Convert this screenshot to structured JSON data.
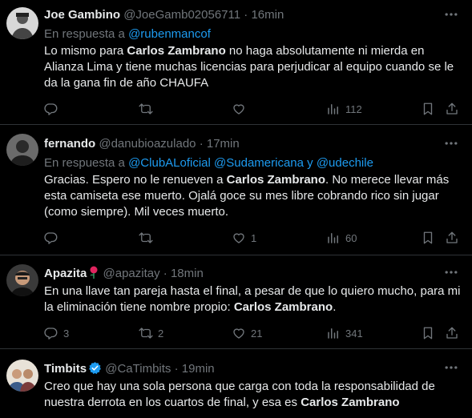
{
  "tweets": [
    {
      "name": "Joe Gambino",
      "handle": "@JoeGamb02056711",
      "dot": "·",
      "time": "16min",
      "reply_prefix": "En respuesta a ",
      "reply_targets": [
        "@rubenmancof"
      ],
      "text_parts": [
        "Lo mismo para ",
        "Carlos Zambrano",
        " no haga absolutamente ni mierda en Alianza Lima y tiene muchas licencias para perjudicar al equipo cuando se le da la gana fin de año CHAUFA"
      ],
      "replies": "",
      "retweets": "",
      "likes": "",
      "views": "112"
    },
    {
      "name": "fernando",
      "handle": "@danubioazulado",
      "dot": "·",
      "time": "17min",
      "reply_prefix": "En respuesta a ",
      "reply_targets": [
        "@ClubALoficial",
        "@Sudamericana",
        "@udechile"
      ],
      "reply_joiners": [
        " ",
        " y "
      ],
      "text_parts": [
        "Gracias. Espero no le renueven a ",
        "Carlos Zambrano",
        ". No merece llevar más esta camiseta ese muerto. Ojalá goce su mes libre cobrando rico sin jugar (como siempre). Mil veces muerto."
      ],
      "replies": "",
      "retweets": "",
      "likes": "1",
      "views": "60"
    },
    {
      "name": "Apazita",
      "handle": "@apazitay",
      "dot": "·",
      "time": "18min",
      "text_parts": [
        "En una llave tan pareja hasta el final, a pesar de que lo quiero mucho, para mi la eliminación tiene nombre propio: ",
        "Carlos Zambrano",
        "."
      ],
      "replies": "3",
      "retweets": "2",
      "likes": "21",
      "views": "341"
    },
    {
      "name": "Timbits",
      "handle": "@CaTimbits",
      "dot": "·",
      "time": "19min",
      "text_parts": [
        "Creo que hay una sola persona que carga con toda la responsabilidad de nuestra derrota en los cuartos de final, y esa es ",
        "Carlos Zambrano",
        ""
      ]
    }
  ],
  "icons": {
    "more": "more-icon",
    "reply": "reply-icon",
    "retweet": "retweet-icon",
    "like": "heart-icon",
    "views": "views-icon",
    "bookmark": "bookmark-icon",
    "share": "share-icon",
    "verified": "verified-icon",
    "rose": "rose-icon"
  },
  "colors": {
    "bg": "#000000",
    "text": "#e7e9ea",
    "muted": "#71767b",
    "link": "#1d9bf0",
    "divider": "#2f3336"
  }
}
